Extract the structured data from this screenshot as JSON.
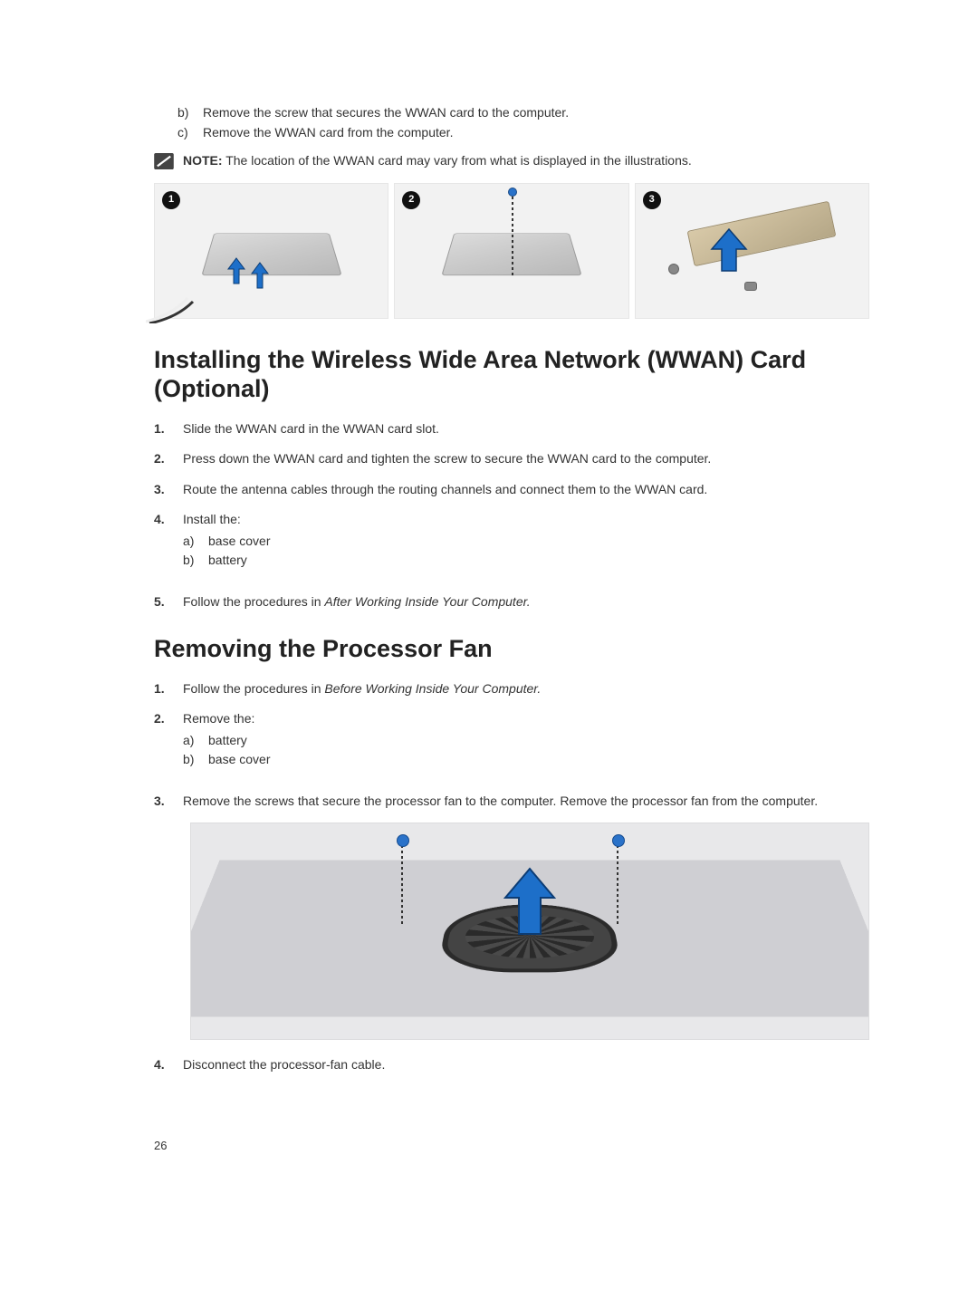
{
  "top": {
    "items": [
      {
        "marker": "b)",
        "text": "Remove the screw that secures the WWAN card to the computer."
      },
      {
        "marker": "c)",
        "text": "Remove the WWAN card from the computer."
      }
    ]
  },
  "note": {
    "label": "NOTE:",
    "text": " The location of the WWAN card may vary from what is displayed in the illustrations."
  },
  "panels": {
    "p1": "1",
    "p2": "2",
    "p3": "3"
  },
  "section1": {
    "title": "Installing the Wireless Wide Area Network (WWAN) Card (Optional)",
    "steps": [
      {
        "num": "1.",
        "text": "Slide the WWAN card in the WWAN card slot."
      },
      {
        "num": "2.",
        "text": "Press down the WWAN card and tighten the screw to secure the WWAN card to the computer."
      },
      {
        "num": "3.",
        "text": "Route the antenna cables through the routing channels and connect them to the WWAN card."
      },
      {
        "num": "4.",
        "text": "Install the:",
        "subs": [
          {
            "marker": "a)",
            "text": "base cover"
          },
          {
            "marker": "b)",
            "text": "battery"
          }
        ]
      },
      {
        "num": "5.",
        "prefix": "Follow the procedures in ",
        "italic": "After Working Inside Your Computer."
      }
    ]
  },
  "section2": {
    "title": "Removing the Processor Fan",
    "steps": [
      {
        "num": "1.",
        "prefix": "Follow the procedures in ",
        "italic": "Before Working Inside Your Computer."
      },
      {
        "num": "2.",
        "text": "Remove the:",
        "subs": [
          {
            "marker": "a)",
            "text": "battery"
          },
          {
            "marker": "b)",
            "text": "base cover"
          }
        ]
      },
      {
        "num": "3.",
        "text": "Remove the screws that secure the processor fan to the computer. Remove the processor fan from the computer."
      },
      {
        "num": "4.",
        "text": "Disconnect the processor-fan cable."
      }
    ]
  },
  "pageNumber": "26"
}
